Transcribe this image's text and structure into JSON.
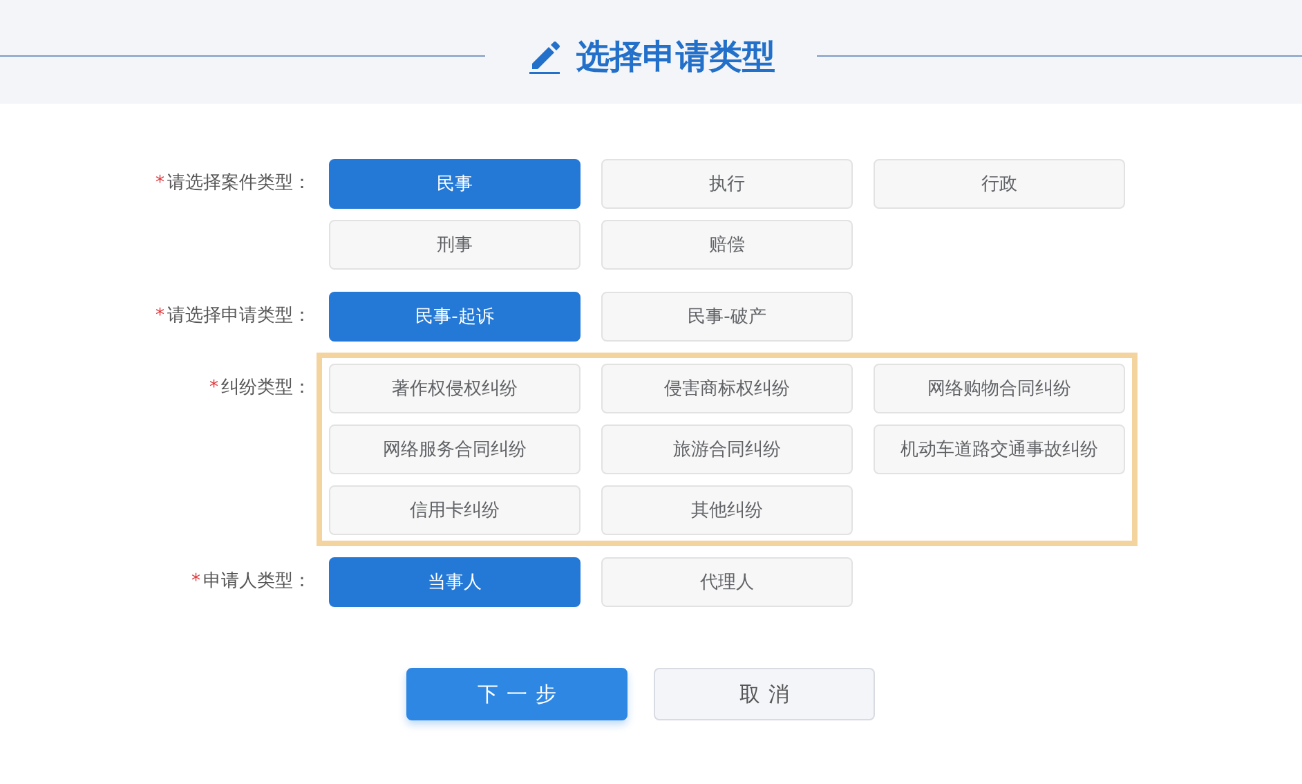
{
  "header": {
    "title": "选择申请类型"
  },
  "fields": [
    {
      "label": "请选择案件类型：",
      "required_mark": "*",
      "highlighted": false,
      "options": [
        {
          "label": "民事",
          "selected": true
        },
        {
          "label": "执行",
          "selected": false
        },
        {
          "label": "行政",
          "selected": false
        },
        {
          "label": "刑事",
          "selected": false
        },
        {
          "label": "赔偿",
          "selected": false
        }
      ]
    },
    {
      "label": "请选择申请类型：",
      "required_mark": "*",
      "highlighted": false,
      "options": [
        {
          "label": "民事-起诉",
          "selected": true
        },
        {
          "label": "民事-破产",
          "selected": false
        }
      ]
    },
    {
      "label": "纠纷类型：",
      "required_mark": "*",
      "highlighted": true,
      "options": [
        {
          "label": "著作权侵权纠纷",
          "selected": false
        },
        {
          "label": "侵害商标权纠纷",
          "selected": false
        },
        {
          "label": "网络购物合同纠纷",
          "selected": false
        },
        {
          "label": "网络服务合同纠纷",
          "selected": false
        },
        {
          "label": "旅游合同纠纷",
          "selected": false
        },
        {
          "label": "机动车道路交通事故纠纷",
          "selected": false
        },
        {
          "label": "信用卡纠纷",
          "selected": false
        },
        {
          "label": "其他纠纷",
          "selected": false
        }
      ]
    },
    {
      "label": "申请人类型：",
      "required_mark": "*",
      "highlighted": false,
      "options": [
        {
          "label": "当事人",
          "selected": true
        },
        {
          "label": "代理人",
          "selected": false
        }
      ]
    }
  ],
  "buttons": [
    {
      "label": "下一步",
      "kind": "primary"
    },
    {
      "label": "取消",
      "kind": "secondary"
    }
  ]
}
